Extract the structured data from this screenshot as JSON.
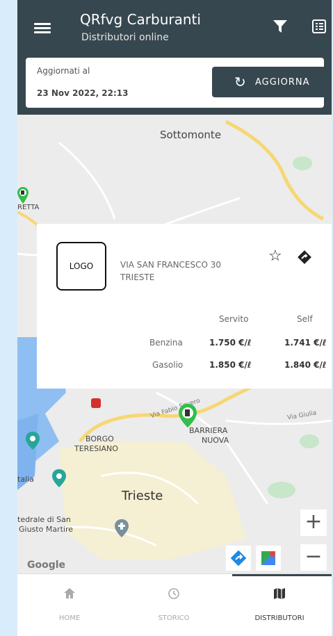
{
  "appbar": {
    "title": "QRfvg Carburanti",
    "subtitle": "Distributori online"
  },
  "update": {
    "label": "Aggiornati al",
    "date": "23 Nov 2022, 22:13",
    "button_label": "AGGIORNA"
  },
  "map": {
    "labels": [
      "Sottomonte",
      "RETTA",
      "BORGO",
      "TERESIANO",
      "BARRIERA",
      "NUOVA",
      "Trieste",
      "tedrale di San",
      "Giusto Martire",
      "Via Giulia",
      "Via Fabio Severo",
      "talia",
      "Google"
    ]
  },
  "station": {
    "logo_text": "LOGO",
    "address_line1": "VIA SAN FRANCESCO 30",
    "address_line2": "TRIESTE",
    "columns": [
      "Servito",
      "Self"
    ],
    "rows": [
      {
        "fuel": "Benzina",
        "servito": "1.750 €/ℓ",
        "self": "1.741 €/ℓ"
      },
      {
        "fuel": "Gasolio",
        "servito": "1.850 €/ℓ",
        "self": "1.840 €/ℓ"
      }
    ]
  },
  "nav": {
    "items": [
      {
        "label": "HOME"
      },
      {
        "label": "STORICO"
      },
      {
        "label": "DISTRIBUTORI"
      }
    ]
  },
  "colors": {
    "appbar": "#37474f",
    "accent_green": "#2fbf4a",
    "water": "#8fbff2"
  }
}
